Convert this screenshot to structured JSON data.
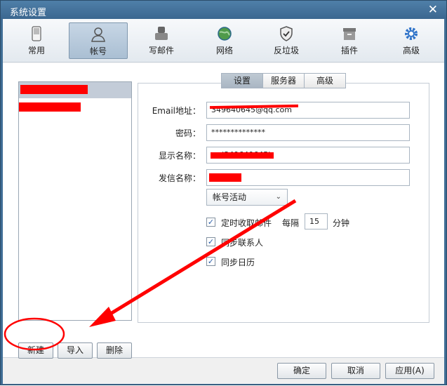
{
  "window": {
    "title": "系统设置"
  },
  "toolbar": {
    "items": [
      {
        "label": "常用",
        "icon": "phone-icon"
      },
      {
        "label": "帐号",
        "icon": "user-icon"
      },
      {
        "label": "写邮件",
        "icon": "compose-icon"
      },
      {
        "label": "网络",
        "icon": "globe-icon"
      },
      {
        "label": "反垃圾",
        "icon": "shield-icon"
      },
      {
        "label": "插件",
        "icon": "plugin-box-icon"
      },
      {
        "label": "高级",
        "icon": "gear-icon"
      }
    ],
    "selected": "帐号"
  },
  "tabs": [
    "设置",
    "服务器",
    "高级"
  ],
  "form": {
    "email_label": "Email地址：",
    "email_value": "349640645@qq.com",
    "password_label": "密码：",
    "password_value": "**************",
    "display_label": "显示名称：",
    "display_value": "(349640645)",
    "sender_label": "发信名称：",
    "sender_value": "",
    "status_select": "帐号活动",
    "auto_fetch_label": "定时收取邮件",
    "every_label": "每隔",
    "interval_value": "15",
    "minutes_label": "分钟",
    "sync_contacts_label": "同步联系人",
    "sync_calendar_label": "同步日历"
  },
  "account_buttons": {
    "new": "新建",
    "import": "导入",
    "delete": "删除"
  },
  "footer": {
    "ok": "确定",
    "cancel": "取消",
    "apply": "应用(A)"
  },
  "colors": {
    "annotation_red": "#ff0000",
    "titlebar": "#3f6d95"
  }
}
